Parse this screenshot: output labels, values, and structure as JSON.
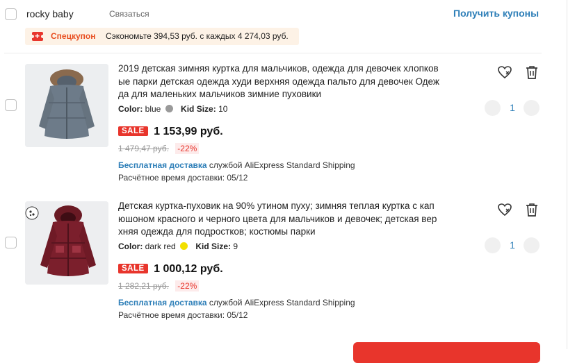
{
  "store": {
    "name": "rocky baby",
    "contact_label": "Связаться",
    "coupons_label": "Получить купоны"
  },
  "coupon": {
    "label": "Спецкупон",
    "text": "Сэкономьте 394,53 руб. с каждых 4 274,03 руб."
  },
  "labels": {
    "color": "Color:",
    "size": "Kid Size:",
    "sale": "SALE",
    "free_shipping": "Бесплатная доставка",
    "carrier": "службой AliExpress Standard Shipping"
  },
  "products": [
    {
      "title": "2019 детская зимняя куртка для мальчиков, одежда для девочек хлопковые парки детская одежда худи верхняя одежда пальто для девочек Одежда для маленьких мальчиков зимние пуховики",
      "color": "blue",
      "swatch_color": "#9a9a9a",
      "size": "10",
      "price": "1 153,99 руб.",
      "old_price": "1 479,47 руб.",
      "discount": "-22%",
      "eta": "Расчётное время доставки: 05/12",
      "quantity": "1"
    },
    {
      "title": "Детская куртка-пуховик на 90% утином пуху; зимняя теплая куртка с капюшоном красного и черного цвета для мальчиков и девочек; детская верхняя одежда для подростков; костюмы парки",
      "color": "dark red",
      "swatch_color": "#f2e000",
      "size": "9",
      "price": "1 000,12 руб.",
      "old_price": "1 282,21 руб.",
      "discount": "-22%",
      "eta": "Расчётное время доставки: 05/12",
      "quantity": "1"
    }
  ],
  "colors": {
    "accent_blue": "#2e7fb8",
    "sale_red": "#e8352c",
    "coupon_orange": "#e84e20"
  }
}
